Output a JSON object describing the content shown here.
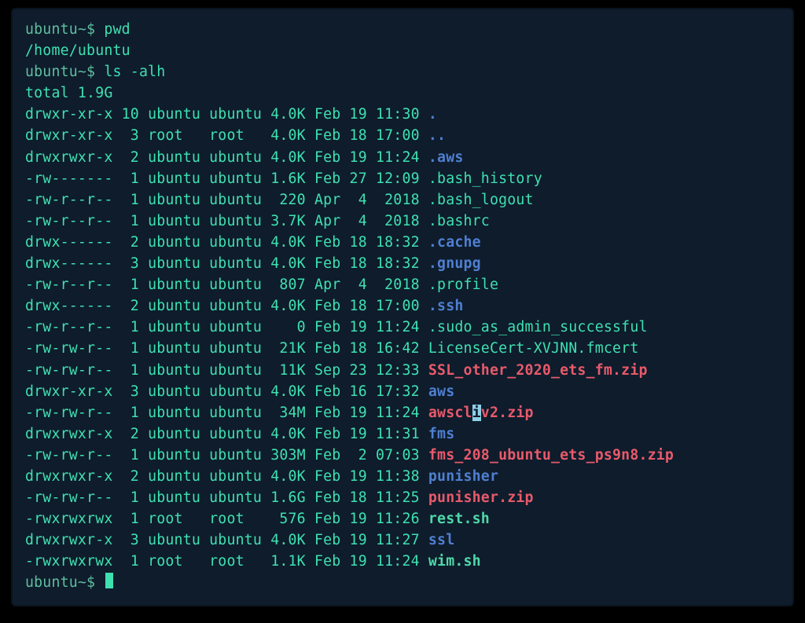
{
  "prompt": "ubuntu~$ ",
  "cmd1": "pwd",
  "pwd_out": "/home/ubuntu",
  "cmd2": "ls -alh",
  "total": "total 1.9G",
  "rows": [
    {
      "meta": "drwxr-xr-x 10 ubuntu ubuntu 4.0K Feb 19 11:30 ",
      "name": ".",
      "cls": "dir"
    },
    {
      "meta": "drwxr-xr-x  3 root   root   4.0K Feb 18 17:00 ",
      "name": "..",
      "cls": "dir"
    },
    {
      "meta": "drwxrwxr-x  2 ubuntu ubuntu 4.0K Feb 19 11:24 ",
      "name": ".aws",
      "cls": "dir"
    },
    {
      "meta": "-rw-------  1 ubuntu ubuntu 1.6K Feb 27 12:09 ",
      "name": ".bash_history",
      "cls": "file"
    },
    {
      "meta": "-rw-r--r--  1 ubuntu ubuntu  220 Apr  4  2018 ",
      "name": ".bash_logout",
      "cls": "file"
    },
    {
      "meta": "-rw-r--r--  1 ubuntu ubuntu 3.7K Apr  4  2018 ",
      "name": ".bashrc",
      "cls": "file"
    },
    {
      "meta": "drwx------  2 ubuntu ubuntu 4.0K Feb 18 18:32 ",
      "name": ".cache",
      "cls": "dir"
    },
    {
      "meta": "drwx------  3 ubuntu ubuntu 4.0K Feb 18 18:32 ",
      "name": ".gnupg",
      "cls": "dir"
    },
    {
      "meta": "-rw-r--r--  1 ubuntu ubuntu  807 Apr  4  2018 ",
      "name": ".profile",
      "cls": "file"
    },
    {
      "meta": "drwx------  2 ubuntu ubuntu 4.0K Feb 18 17:00 ",
      "name": ".ssh",
      "cls": "dir"
    },
    {
      "meta": "-rw-r--r--  1 ubuntu ubuntu    0 Feb 19 11:24 ",
      "name": ".sudo_as_admin_successful",
      "cls": "file"
    },
    {
      "meta": "-rw-rw-r--  1 ubuntu ubuntu  21K Feb 18 16:42 ",
      "name": "LicenseCert-XVJNN.fmcert",
      "cls": "file"
    },
    {
      "meta": "-rw-rw-r--  1 ubuntu ubuntu  11K Sep 23 12:33 ",
      "name": "SSL_other_2020_ets_fm.zip",
      "cls": "zip"
    },
    {
      "meta": "drwxr-xr-x  3 ubuntu ubuntu 4.0K Feb 16 17:32 ",
      "name": "aws",
      "cls": "dir"
    },
    {
      "meta": "-rw-rw-r--  1 ubuntu ubuntu  34M Feb 19 11:24 ",
      "name": "awscliv2.zip",
      "cls": "zip",
      "cursor_at": 5
    },
    {
      "meta": "drwxrwxr-x  2 ubuntu ubuntu 4.0K Feb 19 11:31 ",
      "name": "fms",
      "cls": "dir"
    },
    {
      "meta": "-rw-rw-r--  1 ubuntu ubuntu 303M Feb  2 07:03 ",
      "name": "fms_208_ubuntu_ets_ps9n8.zip",
      "cls": "zip"
    },
    {
      "meta": "drwxrwxr-x  2 ubuntu ubuntu 4.0K Feb 19 11:38 ",
      "name": "punisher",
      "cls": "dir"
    },
    {
      "meta": "-rw-rw-r--  1 ubuntu ubuntu 1.6G Feb 18 11:25 ",
      "name": "punisher.zip",
      "cls": "zip"
    },
    {
      "meta": "-rwxrwxrwx  1 root   root    576 Feb 19 11:26 ",
      "name": "rest.sh",
      "cls": "exe"
    },
    {
      "meta": "drwxrwxr-x  3 ubuntu ubuntu 4.0K Feb 19 11:27 ",
      "name": "ssl",
      "cls": "dir"
    },
    {
      "meta": "-rwxrwxrwx  1 root   root   1.1K Feb 19 11:24 ",
      "name": "wim.sh",
      "cls": "exe"
    }
  ]
}
